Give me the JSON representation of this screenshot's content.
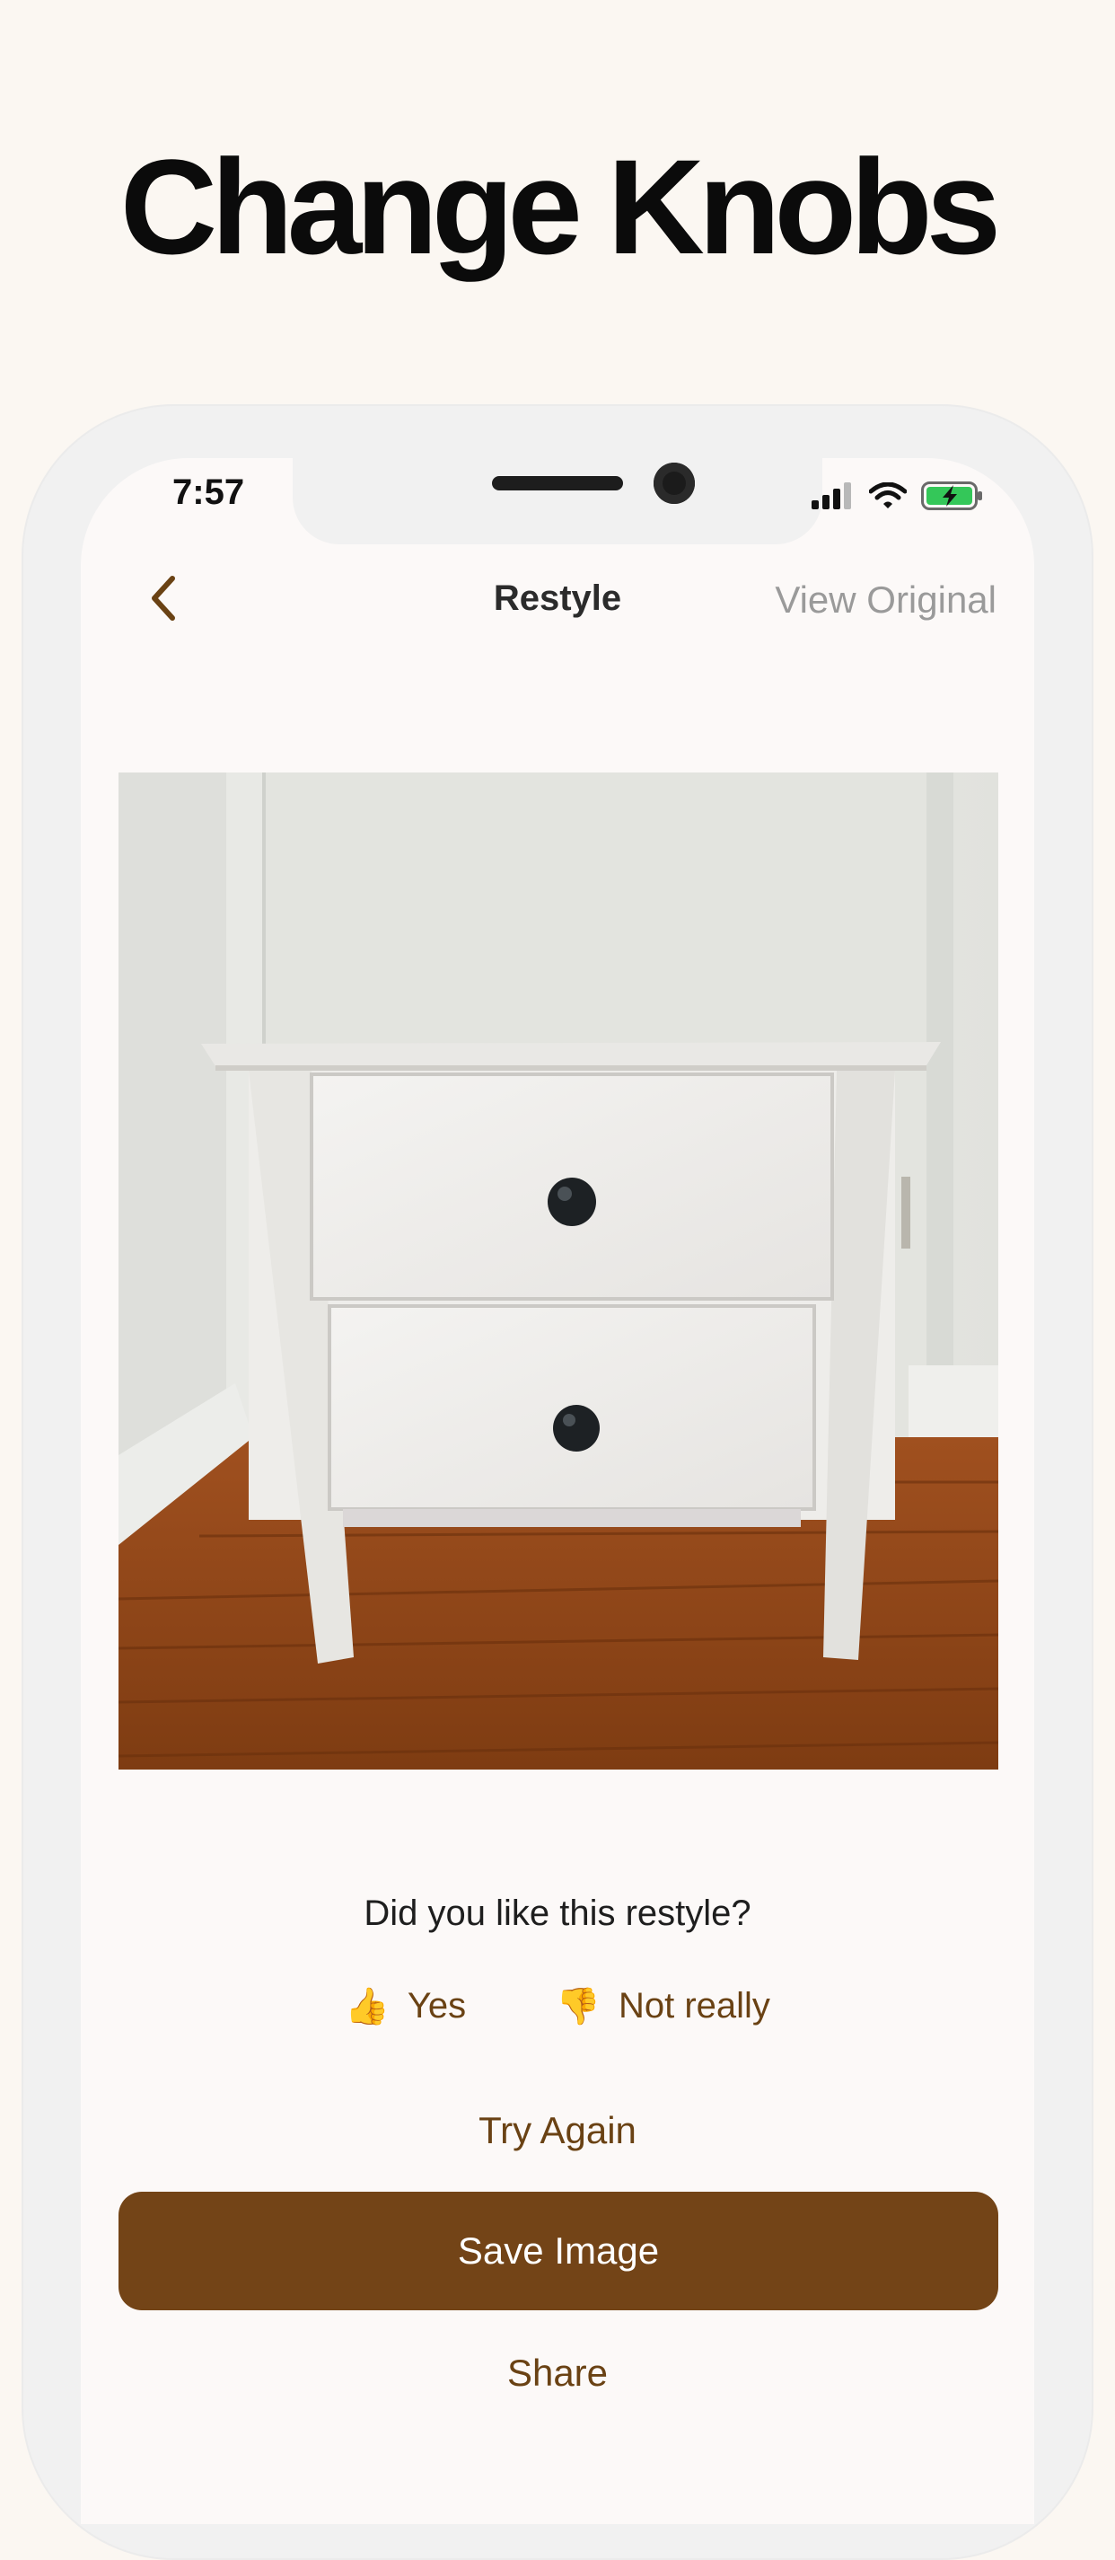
{
  "headline": "Change Knobs",
  "status_bar": {
    "time": "7:57",
    "battery_icon": "battery-charging-icon",
    "wifi_icon": "wifi-icon",
    "signal_icon": "cellular-signal-icon"
  },
  "nav": {
    "back_icon": "chevron-left-icon",
    "title": "Restyle",
    "view_original": "View Original"
  },
  "photo": {
    "subject": "white-nightstand-black-knobs"
  },
  "feedback": {
    "question": "Did you like this restyle?",
    "yes_emoji": "👍",
    "yes_label": "Yes",
    "no_emoji": "👎",
    "no_label": "Not really"
  },
  "actions": {
    "try_again": "Try Again",
    "save_image": "Save Image",
    "share": "Share"
  },
  "colors": {
    "accent": "#734417",
    "accent_text": "#6a4214",
    "background": "#fbf7f2"
  }
}
